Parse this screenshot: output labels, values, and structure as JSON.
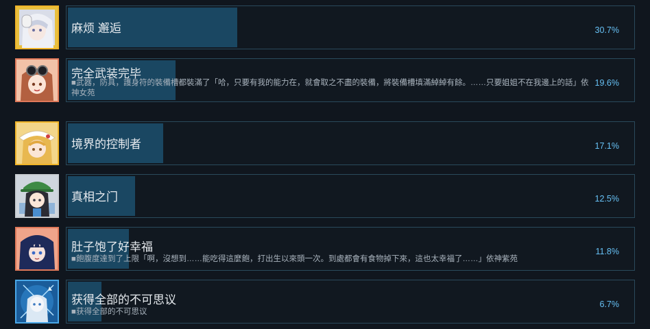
{
  "achievements": [
    {
      "title": "麻烦 邂逅",
      "description": "",
      "percent_label": "30.7%",
      "percent": 30.7,
      "avatar_icon": "white-haired-character-icon",
      "frame_color": "#f0b428"
    },
    {
      "title": "完全武装完毕",
      "description": "■武器，防具，護身符的裝備槽都裝滿了「哈，只要有我的能力在，就會取之不盡的裝備，將裝備槽填滿綽綽有餘。……只要姐姐不在我邊上的話」依神女苑",
      "percent_label": "19.6%",
      "percent": 19.6,
      "avatar_icon": "goggles-character-icon",
      "frame_color": "#e0795a"
    },
    {
      "title": "境界的控制者",
      "description": "",
      "percent_label": "17.1%",
      "percent": 17.1,
      "avatar_icon": "blonde-character-icon",
      "frame_color": "#f0b428"
    },
    {
      "title": "真相之门",
      "description": "",
      "percent_label": "12.5%",
      "percent": 12.5,
      "avatar_icon": "green-hat-character-icon",
      "frame_color": "#c8cdd2"
    },
    {
      "title": "肚子饱了好幸福",
      "description": "■飽腹度達到了上限「啊，沒想到……能吃得這麼飽，打出生以來頭一次。到處都會有食物掉下來，這也太幸福了……」依神紫苑",
      "percent_label": "11.8%",
      "percent": 11.8,
      "avatar_icon": "dark-haired-character-icon",
      "frame_color": "#e0795a"
    },
    {
      "title": "获得全部的不可思议",
      "description": "■获得全部的不可思议",
      "percent_label": "6.7%",
      "percent": 6.7,
      "avatar_icon": "ice-character-icon",
      "frame_color": "#4aa8e8"
    }
  ]
}
